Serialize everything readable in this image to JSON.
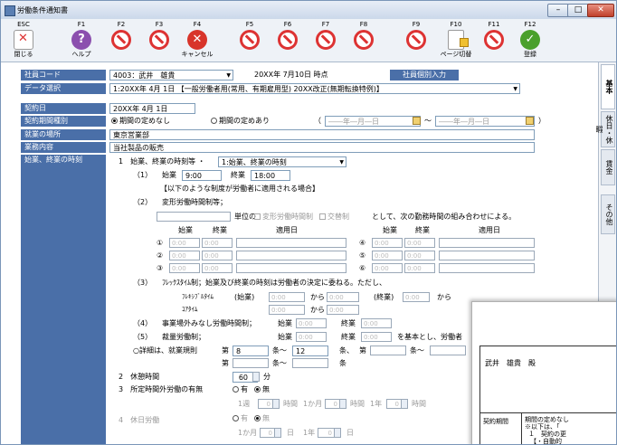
{
  "window": {
    "title": "労働条件通知書"
  },
  "toolbar": [
    {
      "key": "ESC",
      "label": "閉じる",
      "icon": "close-doc-icon"
    },
    {
      "key": "F1",
      "label": "ヘルプ",
      "icon": "help-icon"
    },
    {
      "key": "F2",
      "label": "",
      "icon": "disabled-icon"
    },
    {
      "key": "F3",
      "label": "",
      "icon": "disabled-icon"
    },
    {
      "key": "F4",
      "label": "キャンセル",
      "icon": "cancel-icon"
    },
    {
      "key": "F5",
      "label": "",
      "icon": "disabled-icon"
    },
    {
      "key": "F6",
      "label": "",
      "icon": "disabled-icon"
    },
    {
      "key": "F7",
      "label": "",
      "icon": "disabled-icon"
    },
    {
      "key": "F8",
      "label": "",
      "icon": "disabled-icon"
    },
    {
      "key": "F9",
      "label": "",
      "icon": "disabled-icon"
    },
    {
      "key": "F10",
      "label": "ページ切替",
      "icon": "page-switch-icon"
    },
    {
      "key": "F11",
      "label": "",
      "icon": "disabled-icon"
    },
    {
      "key": "F12",
      "label": "登録",
      "icon": "register-icon"
    }
  ],
  "header": {
    "employee_code_label": "社員コード",
    "employee_value": "4003：武井　雄貴",
    "as_of": "20XX年 7月10日 時点",
    "employee_input_button": "社員個別入力",
    "data_select_label": "データ選択",
    "data_select_value": "1:20XX年 4月 1日 【一般労働者用(常用、有期雇用型) 20XX改正(無期転換特例)】"
  },
  "form": {
    "contract_date_label": "契約日",
    "contract_date_value": "20XX年 4月 1日",
    "contract_type_label": "契約期間種別",
    "contract_type_opt1": "期間の定めなし",
    "contract_type_opt2": "期間の定めあり",
    "date_from_placeholder": "――年―月―日",
    "date_to_placeholder": "――年―月―日",
    "paren_open": "（",
    "paren_close": "）",
    "tilde": "〜",
    "workplace_label": "就業の場所",
    "workplace_value": "東京営業部",
    "job_label": "業務内容",
    "job_value": "当社製品の販売",
    "hours_label": "始業、終業の時刻"
  },
  "hours": {
    "item1": "1　始業、終業の時刻等 ・",
    "item1_select": "1:始業、終業の時刻",
    "row1_num": "（1）",
    "start_label": "始業",
    "start_value": "9:00",
    "end_label": "終業",
    "end_value": "18:00",
    "note": "【以下のような制度が労働者に適用される場合】",
    "row2_num": "（2）",
    "row2_label": "変形労働時間制等；",
    "unit_label": "単位の",
    "opt_variable": "変形労働時間制",
    "opt_shift": "交替制",
    "combo_text": "として、次の勤務時間の組み合わせによる。",
    "col_start": "始業",
    "col_end": "終業",
    "col_day": "適用日",
    "time_placeholder": "0:00",
    "circled_left": [
      "①",
      "②",
      "③"
    ],
    "circled_right": [
      "④",
      "⑤",
      "⑥"
    ],
    "row3_num": "（3）",
    "row3_text": "ﾌﾚｯｸｽﾀｲﾑ制；始業及び終業の時刻は労働者の決定に委ねる。ただし、",
    "flex_time": "ﾌﾚｷｼﾌﾞﾙﾀｲﾑ",
    "core_time": "ｺｱﾀｲﾑ",
    "paren_start": "(始業)",
    "paren_end": "(終業)",
    "from": "から",
    "row4_num": "（4）",
    "row4_text": "事業場外みなし労働時間制；",
    "row5_num": "（5）",
    "row5_text": "裁量労働制；",
    "row5_base": "を基本とし、労働者",
    "detail_text": "○詳細は、就業規則",
    "article_first": "第",
    "article_first_value": "8",
    "article_mid": "条〜",
    "article_second_value": "12",
    "article_end": "条、",
    "article_suffix": "条〜",
    "article_last": "条",
    "break_label": "2　休憩時間",
    "break_value": "60",
    "minutes": "分",
    "overtime_label": "3　所定時間外労働の有無",
    "yes": "有",
    "no": "無",
    "week": "1週",
    "month": "1か月",
    "year": "1年",
    "hour_unit": "時間",
    "holiday_label": "4　休日労働",
    "day_unit": "日",
    "zero": "0"
  },
  "side_tabs": [
    "基本",
    "休日・休暇",
    "賃金",
    "その他"
  ],
  "document": {
    "addressee": "武井　雄貴　殿",
    "period_label": "契約期間",
    "period_text1": "期間の定めなし",
    "period_text2": "※以下は、「",
    "period_text3": "１　契約の更",
    "period_text4": "【・自動的"
  }
}
